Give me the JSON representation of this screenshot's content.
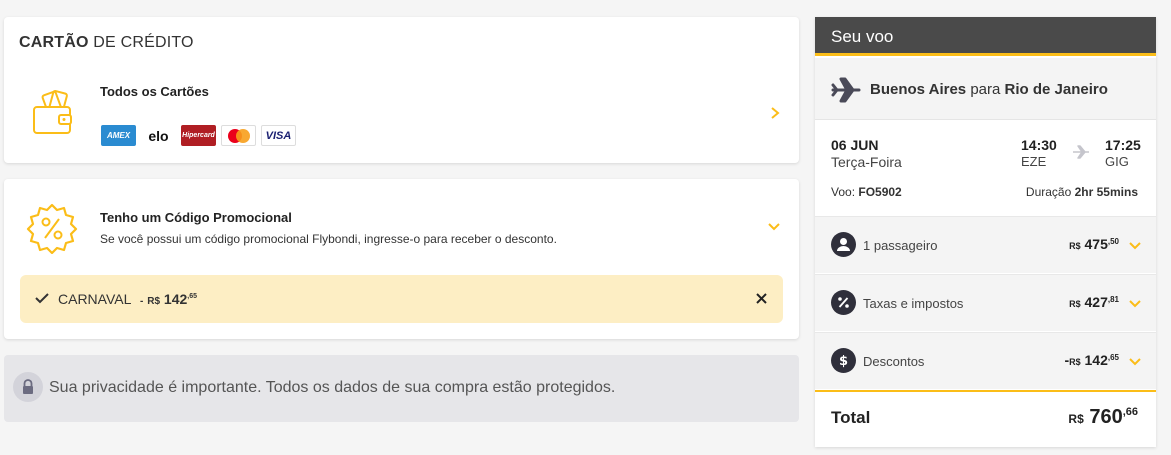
{
  "credit_card": {
    "title_bold": "CARTÃO",
    "title_rest": "DE CRÉDITO",
    "all_cards_label": "Todos os Cartões",
    "card_brands": [
      "AMEX",
      "elo",
      "Hipercard",
      "Mastercard",
      "VISA"
    ],
    "icon": "wallet-icon"
  },
  "promo": {
    "title": "Tenho um Código Promocional",
    "description": "Se você possui um código promocional Flybondi, ingresse-o para receber o desconto.",
    "applied_code": "CARNAVAL",
    "applied_minus": "-",
    "applied_currency": "R$",
    "applied_amount": "142",
    "applied_cents": ",65"
  },
  "privacy": {
    "text": "Sua privacidade é importante. Todos os dados de sua compra estão protegidos."
  },
  "flight": {
    "header": "Seu voo",
    "origin": "Buenos Aires",
    "connector": "para",
    "destination": "Rio de Janeiro",
    "date": "06 JUN",
    "weekday": "Terça-Foira",
    "depart_time": "14:30",
    "depart_code": "EZE",
    "arrive_time": "17:25",
    "arrive_code": "GIG",
    "flight_label": "Voo:",
    "flight_number": "FO5902",
    "duration_label": "Duração",
    "duration": "2hr 55mins",
    "rows": [
      {
        "label": "1 passageiro",
        "sign": "",
        "currency": "R$",
        "amount": "475",
        "cents": ",50",
        "icon": "user-icon"
      },
      {
        "label": "Taxas e impostos",
        "sign": "",
        "currency": "R$",
        "amount": "427",
        "cents": ",81",
        "icon": "percent-icon"
      },
      {
        "label": "Descontos",
        "sign": "-",
        "currency": "R$",
        "amount": "142",
        "cents": ",65",
        "icon": "dollar-icon"
      }
    ],
    "total_label": "Total",
    "total_currency": "R$",
    "total_amount": "760",
    "total_cents": ",66"
  },
  "colors": {
    "accent": "#fbbd18",
    "header_bg": "#4a4a4a",
    "promo_bg": "#fdeec4"
  }
}
